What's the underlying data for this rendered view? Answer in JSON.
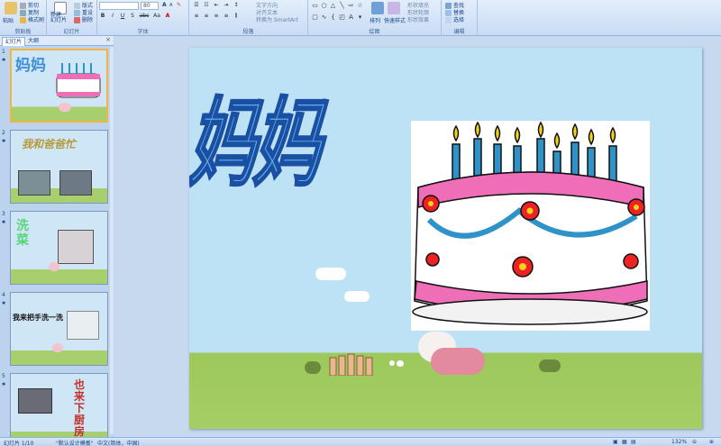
{
  "ribbon": {
    "clipboard": {
      "label": "剪贴板",
      "paste": "粘贴",
      "cut": "剪切",
      "copy": "复制",
      "format_painter": "格式刷"
    },
    "slides": {
      "label": "幻灯片",
      "new_slide": "新建\n幻灯片",
      "layout": "版式",
      "reset": "重设",
      "delete": "删除"
    },
    "font": {
      "label": "字体",
      "font_name": "",
      "font_size": "80",
      "bold": "B",
      "italic": "I",
      "underline": "U",
      "shadow": "S",
      "strike": "abc",
      "aa": "Aa",
      "grow": "A",
      "shrink": "A"
    },
    "paragraph": {
      "label": "段落",
      "text_direction": "文字方向",
      "align_text": "对齐文本",
      "convert_smartart": "转换为 SmartArt"
    },
    "drawing": {
      "label": "绘图",
      "arrange": "排列",
      "quick_styles": "快速样式",
      "shape_fill": "形状填充",
      "shape_outline": "形状轮廓",
      "shape_effects": "形状效果"
    },
    "editing": {
      "label": "编辑",
      "find": "查找",
      "replace": "替换",
      "select": "选择"
    }
  },
  "left_pane": {
    "tabs": [
      {
        "label": "幻灯片"
      },
      {
        "label": "大纲"
      }
    ],
    "close": "×",
    "slides": [
      {
        "num": "1",
        "text": "妈妈"
      },
      {
        "num": "2",
        "text": "我和爸爸忙"
      },
      {
        "num": "3",
        "text": "洗菜"
      },
      {
        "num": "4",
        "text": "我来把手洗一洗"
      },
      {
        "num": "5",
        "text": "也来下厨房"
      }
    ]
  },
  "slide": {
    "title": "妈妈"
  },
  "status": {
    "slide_info": "幻灯片 1/10",
    "theme": "\"默认设计模板\"",
    "language": "中文(简体，中国)",
    "zoom": "132%"
  },
  "colors": {
    "accent": "#15428b",
    "slide_sky": "#bde2f6",
    "slide_grass": "#a5cf64",
    "selected_thumb": "#f5b440"
  }
}
